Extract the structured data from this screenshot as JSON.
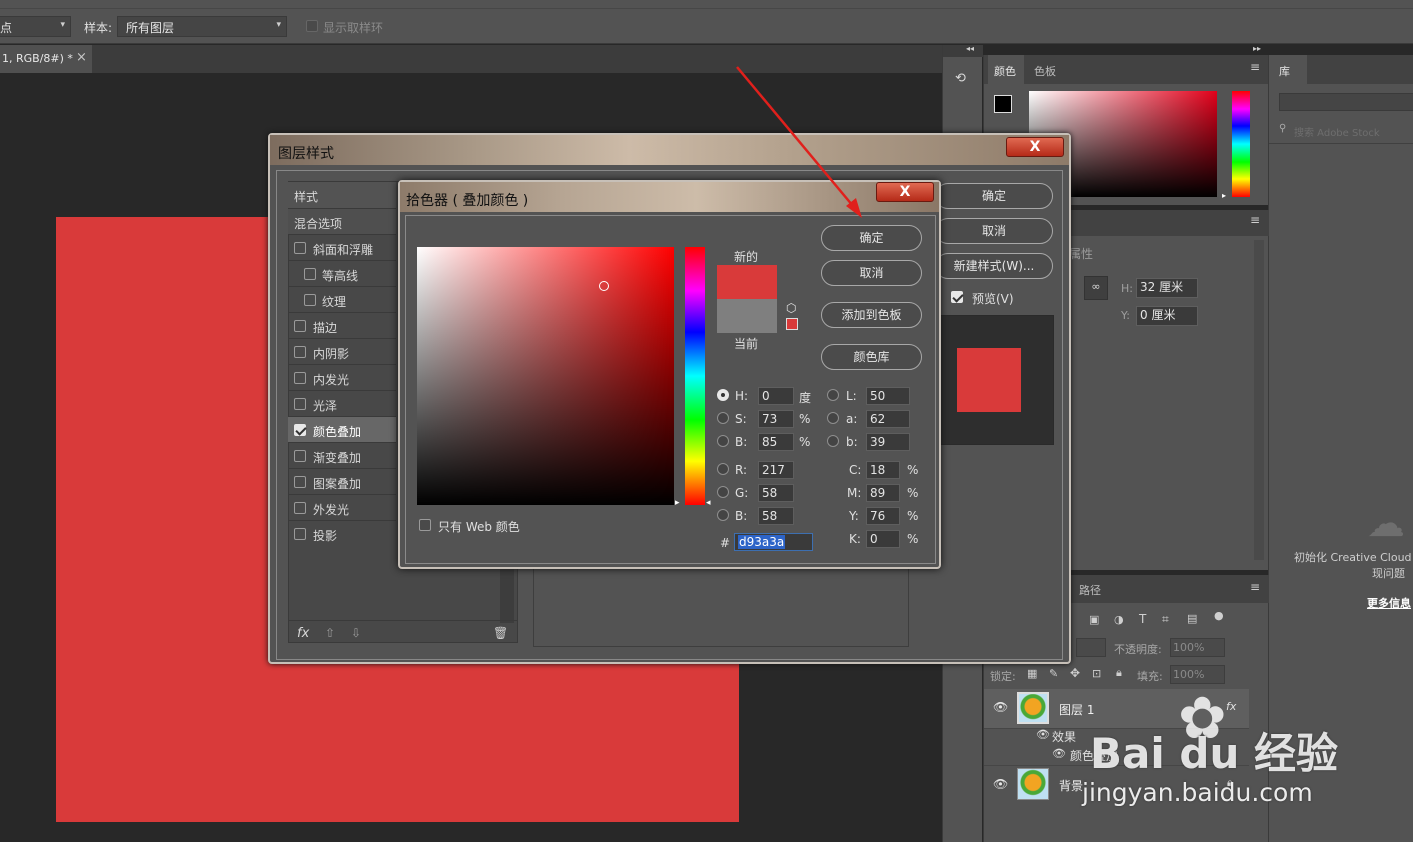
{
  "options_bar": {
    "left_select": "点",
    "sample_label": "样本:",
    "sample_value": "所有图层",
    "show_ring_label": "显示取样环"
  },
  "doc_tab": {
    "title": "1, RGB/8#) *",
    "close": "×"
  },
  "layer_style": {
    "title": "图层样式",
    "close": "X",
    "styles_header": "样式",
    "blend_options": "混合选项",
    "items": [
      {
        "label": "斜面和浮雕",
        "checked": false
      },
      {
        "label": "等高线",
        "checked": false
      },
      {
        "label": "纹理",
        "checked": false
      },
      {
        "label": "描边",
        "checked": false
      },
      {
        "label": "内阴影",
        "checked": false
      },
      {
        "label": "内发光",
        "checked": false
      },
      {
        "label": "光泽",
        "checked": false
      },
      {
        "label": "颜色叠加",
        "checked": true
      },
      {
        "label": "渐变叠加",
        "checked": false
      },
      {
        "label": "图案叠加",
        "checked": false
      },
      {
        "label": "外发光",
        "checked": false
      },
      {
        "label": "投影",
        "checked": false
      }
    ],
    "fx": "fx",
    "ok": "确定",
    "cancel": "取消",
    "new_style": "新建样式(W)...",
    "preview": "预览(V)",
    "preview_checked": true
  },
  "color_picker": {
    "title": "拾色器 ( 叠加颜色 )",
    "close": "X",
    "new_label": "新的",
    "current_label": "当前",
    "ok": "确定",
    "cancel": "取消",
    "add_swatch": "添加到色板",
    "color_libraries": "颜色库",
    "web_only": "只有 Web 颜色",
    "h_label": "H:",
    "h": "0",
    "h_unit": "度",
    "s_label": "S:",
    "s": "73",
    "s_unit": "%",
    "bb_label": "B:",
    "bb": "85",
    "bb_unit": "%",
    "r_label": "R:",
    "r": "217",
    "g_label": "G:",
    "g": "58",
    "b_label": "B:",
    "b": "58",
    "l_label": "L:",
    "l": "50",
    "a_label": "a:",
    "a": "62",
    "lab_b_label": "b:",
    "lab_b": "39",
    "c_label": "C:",
    "c": "18",
    "m_label": "M:",
    "m": "89",
    "y_label": "Y:",
    "y": "76",
    "k_label": "K:",
    "k": "0",
    "pct": "%",
    "hash": "#",
    "hex": "d93a3a",
    "new_color": "#d93a3a",
    "current_color": "#7f7f7f"
  },
  "color_panel": {
    "tab_color": "颜色",
    "tab_swatches": "色板",
    "menu": "≡"
  },
  "library_panel": {
    "tab": "库",
    "search_placeholder": "搜索 Adobe Stock",
    "init_text": "初始化 Creative Cloud",
    "problem_text": "现问题",
    "more_info": "更多信息"
  },
  "properties_panel": {
    "title": "属性",
    "h_label": "H:",
    "h_value": "32 厘米",
    "y_label": "Y:",
    "y_value": "0 厘米"
  },
  "layers_panel": {
    "paths_tab": "路径",
    "opacity_label": "不透明度:",
    "opacity_value": "100%",
    "lock_label": "锁定:",
    "fill_label": "填充:",
    "fill_value": "100%",
    "layer1": "图层 1",
    "fx": "fx",
    "effects": "效果",
    "color_overlay": "颜色叠加",
    "background": "背景"
  },
  "watermark": {
    "brand": "Bai du 经验",
    "url": "jingyan.baidu.com"
  },
  "colors": {
    "canvas_red": "#d93a3a",
    "arrow": "#e0201c"
  }
}
